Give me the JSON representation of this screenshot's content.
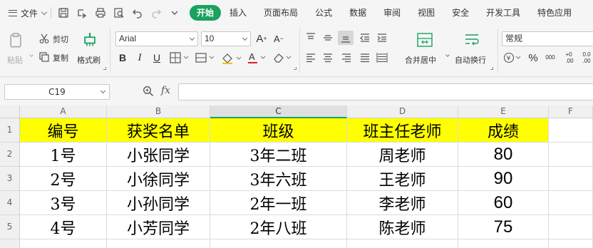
{
  "menu": {
    "file_label": "文件",
    "tabs": [
      {
        "label": "开始"
      },
      {
        "label": "插入"
      },
      {
        "label": "页面布局"
      },
      {
        "label": "公式"
      },
      {
        "label": "数据"
      },
      {
        "label": "审阅"
      },
      {
        "label": "视图"
      },
      {
        "label": "安全"
      },
      {
        "label": "开发工具"
      },
      {
        "label": "特色应用"
      }
    ],
    "active_tab": "开始",
    "accent_color": "#1aa260"
  },
  "ribbon": {
    "paste_label": "粘贴",
    "cut_label": "剪切",
    "copy_label": "复制",
    "format_painter_label": "格式刷",
    "font_name": "Arial",
    "font_size": "10",
    "merge_center_label": "合并居中",
    "wrap_text_label": "自动换行",
    "number_format": "常规",
    "thousands_glyph": "000",
    "decimal_increase": "+0\n.00",
    "decimal_decrease": "0.0\n.00"
  },
  "formula_bar": {
    "cell_ref": "C19",
    "fx_label": "fx",
    "formula": ""
  },
  "sheet": {
    "columns": [
      "A",
      "B",
      "C",
      "D",
      "E",
      "F"
    ],
    "selected_column": "C",
    "row_numbers": [
      "1",
      "2",
      "3",
      "4",
      "5"
    ],
    "header_fill": "#ffff00",
    "header_row": [
      "编号",
      "获奖名单",
      "班级",
      "班主任老师",
      "成绩"
    ],
    "rows": [
      [
        "1号",
        "小张同学",
        "3年二班",
        "周老师",
        "80"
      ],
      [
        "2号",
        "小徐同学",
        "3年六班",
        "王老师",
        "90"
      ],
      [
        "3号",
        "小孙同学",
        "2年一班",
        "李老师",
        "60"
      ],
      [
        "4号",
        "小芳同学",
        "2年八班",
        "陈老师",
        "75"
      ]
    ]
  }
}
